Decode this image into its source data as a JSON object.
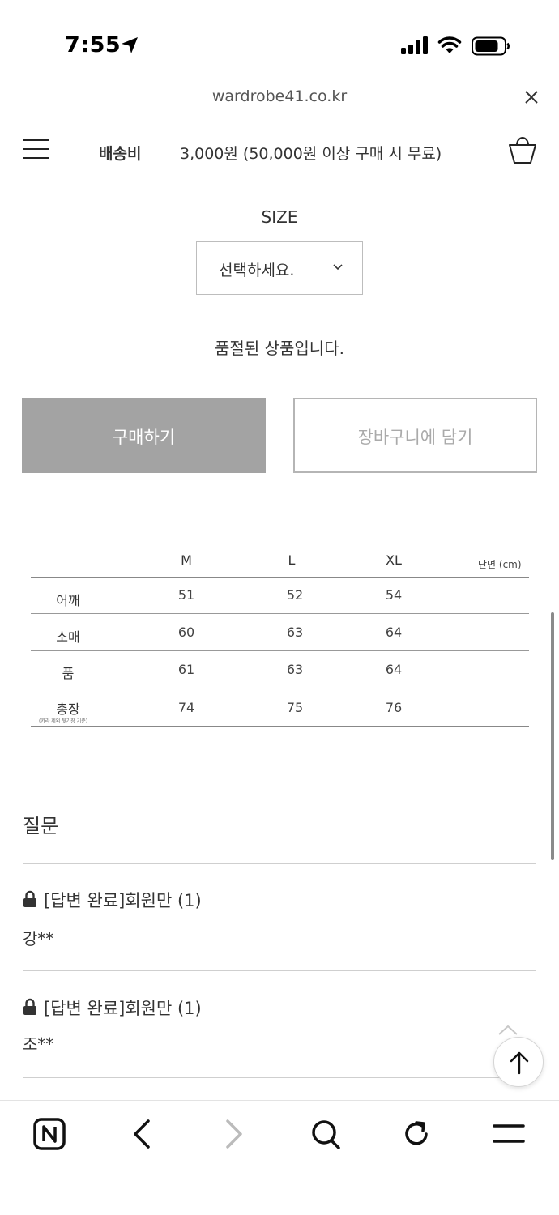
{
  "status_bar": {
    "time": "7:55",
    "icons": [
      "location-arrow-icon",
      "cellular-signal-icon",
      "wifi-icon",
      "battery-icon"
    ]
  },
  "browser": {
    "url": "wardrobe41.co.kr",
    "close_icon": "close-icon"
  },
  "header": {
    "menu_icon": "hamburger-menu-icon",
    "shipping_label": "배송비",
    "shipping_value": "3,000원 (50,000원 이상 구매 시 무료)",
    "cart_icon": "shopping-basket-icon"
  },
  "product": {
    "size_label": "SIZE",
    "size_select": {
      "selected": "선택하세요."
    },
    "soldout_message": "품절된 상품입니다.",
    "buy_button": "구매하기",
    "add_to_cart_button": "장바구니에 담기"
  },
  "size_chart": {
    "unit": "단면 (cm)",
    "columns": [
      "M",
      "L",
      "XL"
    ],
    "rows": [
      {
        "label": "어깨",
        "values": [
          "51",
          "52",
          "54"
        ]
      },
      {
        "label": "소매",
        "values": [
          "60",
          "63",
          "64"
        ]
      },
      {
        "label": "품",
        "values": [
          "61",
          "63",
          "64"
        ]
      },
      {
        "label": "총장",
        "note": "(카라 제외 뒷기장 기준)",
        "values": [
          "74",
          "75",
          "76"
        ]
      }
    ]
  },
  "questions": {
    "title": "질문",
    "items": [
      {
        "title": "[답변 완료]회원만 (1)",
        "author": "강**"
      },
      {
        "title": "[답변 완료]회원만 (1)",
        "author": "조**"
      }
    ]
  },
  "toolbar": {
    "items": [
      "naver-home-icon",
      "back-icon",
      "forward-icon",
      "search-icon",
      "reload-icon",
      "menu-icon"
    ]
  },
  "colors": {
    "buy_button_bg": "#a3a3a3",
    "cart_button_border": "#b5b5b5",
    "text": "#333333"
  }
}
